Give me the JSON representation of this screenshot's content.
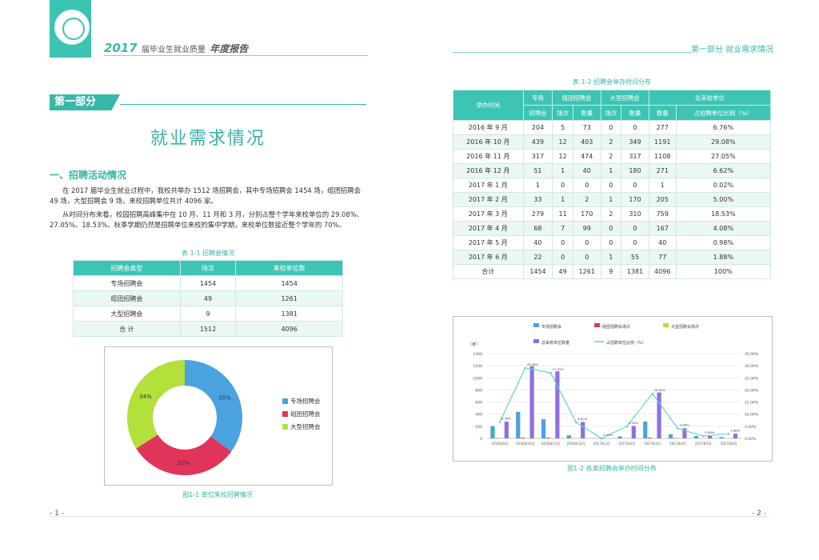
{
  "header": {
    "year": "2017",
    "title_sub": "届毕业生就业质量",
    "title_strong": "年度报告",
    "right_label": "第一部分   就业需求情况"
  },
  "left": {
    "section_label": "第一部分",
    "big_title": "就业需求情况",
    "h2": "一、招聘活动情况",
    "para1": "在 2017 届毕业生就业过程中，我校共举办 1512 场招聘会，其中专场招聘会 1454 场，组团招聘会 49 场，大型招聘会 9 场，来校招聘单位共计 4096 家。",
    "para2": "从时间分布来看，校园招聘高峰集中在 10 月、11 月和 3 月，分别占整个学年来校单位的 29.08%、27.05%、18.53%。秋季学期仍然是招聘单位来校的集中学期，来校单位数接近整个学年的 70%。",
    "table1_caption": "表 1-1   招聘会情况",
    "table1": {
      "headers": [
        "招聘会类型",
        "场次",
        "来校单位数"
      ],
      "rows": [
        [
          "专场招聘会",
          "1454",
          "1454"
        ],
        [
          "组团招聘会",
          "49",
          "1261"
        ],
        [
          "大型招聘会",
          "9",
          "1381"
        ],
        [
          "合   计",
          "1512",
          "4096"
        ]
      ]
    },
    "fig1_caption": "图1-1   单位来校招聘情况",
    "page": "- 1 -"
  },
  "right": {
    "table2_caption": "表 1-2   招聘会举办时间分布",
    "table2": {
      "h_time": "举办时间",
      "h_special": "专场",
      "h_group": "组团招聘会",
      "h_large": "大型招聘会",
      "h_total": "总来校单位",
      "sub": [
        "招聘会",
        "场次",
        "数量",
        "场次",
        "数量",
        "数量",
        "占招聘单位比例（%）"
      ],
      "rows": [
        [
          "2016 年 9 月",
          "204",
          "5",
          "73",
          "0",
          "0",
          "277",
          "6.76%"
        ],
        [
          "2016 年 10 月",
          "439",
          "12",
          "403",
          "2",
          "349",
          "1191",
          "29.08%"
        ],
        [
          "2016 年 11 月",
          "317",
          "12",
          "474",
          "2",
          "317",
          "1108",
          "27.05%"
        ],
        [
          "2016 年 12 月",
          "51",
          "1",
          "40",
          "1",
          "180",
          "271",
          "6.62%"
        ],
        [
          "2017 年 1 月",
          "1",
          "0",
          "0",
          "0",
          "0",
          "1",
          "0.02%"
        ],
        [
          "2017 年 2 月",
          "33",
          "1",
          "2",
          "1",
          "170",
          "205",
          "5.00%"
        ],
        [
          "2017 年 3 月",
          "279",
          "11",
          "170",
          "2",
          "310",
          "759",
          "18.53%"
        ],
        [
          "2017 年 4 月",
          "68",
          "7",
          "99",
          "0",
          "0",
          "167",
          "4.08%"
        ],
        [
          "2017 年 5 月",
          "40",
          "0",
          "0",
          "0",
          "0",
          "40",
          "0.98%"
        ],
        [
          "2017 年 6 月",
          "22",
          "0",
          "0",
          "1",
          "55",
          "77",
          "1.88%"
        ],
        [
          "合计",
          "1454",
          "49",
          "1261",
          "9",
          "1381",
          "4096",
          "100%"
        ]
      ]
    },
    "fig2_caption": "图1-2   各类招聘会举办时间分布",
    "page": "- 2 -"
  },
  "chart_data": [
    {
      "type": "pie",
      "categories": [
        "专场招聘会",
        "组团招聘会",
        "大型招聘会"
      ],
      "values": [
        35,
        31,
        34
      ],
      "labels": [
        "35%",
        "31%",
        "34%"
      ],
      "colors": [
        "#4aa3df",
        "#e0345a",
        "#b3e03a"
      ],
      "legend": "right"
    },
    {
      "type": "bar",
      "categories": [
        "2016年9月",
        "2016年10月",
        "2016年11月",
        "2016年12月",
        "2017年1月",
        "2017年2月",
        "2017年3月",
        "2017年4月",
        "2017年5月",
        "2017年6月"
      ],
      "series": [
        {
          "name": "专场招聘会",
          "values": [
            204,
            439,
            317,
            51,
            1,
            33,
            279,
            68,
            40,
            22
          ],
          "color": "#4aa3df"
        },
        {
          "name": "组团招聘会场次",
          "values": [
            5,
            12,
            12,
            1,
            0,
            1,
            11,
            7,
            0,
            0
          ],
          "color": "#e0345a"
        },
        {
          "name": "大型招聘会场次",
          "values": [
            0,
            2,
            2,
            1,
            0,
            1,
            2,
            0,
            0,
            1
          ],
          "color": "#b3e03a"
        },
        {
          "name": "总来校单位数量",
          "values": [
            277,
            1191,
            1108,
            271,
            1,
            205,
            759,
            167,
            40,
            77
          ],
          "color": "#8f6fe0"
        },
        {
          "name": "占招聘单位比例（%）",
          "values": [
            6.76,
            29.08,
            27.05,
            6.62,
            0.02,
            5.0,
            18.53,
            4.08,
            0.98,
            1.88
          ],
          "color": "#5fd6c8",
          "axis": "right",
          "kind": "line"
        }
      ],
      "ylabel": "（家）",
      "ylim": [
        0,
        1400
      ],
      "yticks": [
        "1400",
        "1200",
        "1000",
        "800",
        "600",
        "400",
        "200",
        "0"
      ],
      "y2lim": [
        0,
        35
      ],
      "y2ticks": [
        "35.00%",
        "30.00%",
        "25.00%",
        "20.00%",
        "15.00%",
        "10.00%",
        "5.00%",
        "0.00%"
      ],
      "legend": "top"
    }
  ]
}
